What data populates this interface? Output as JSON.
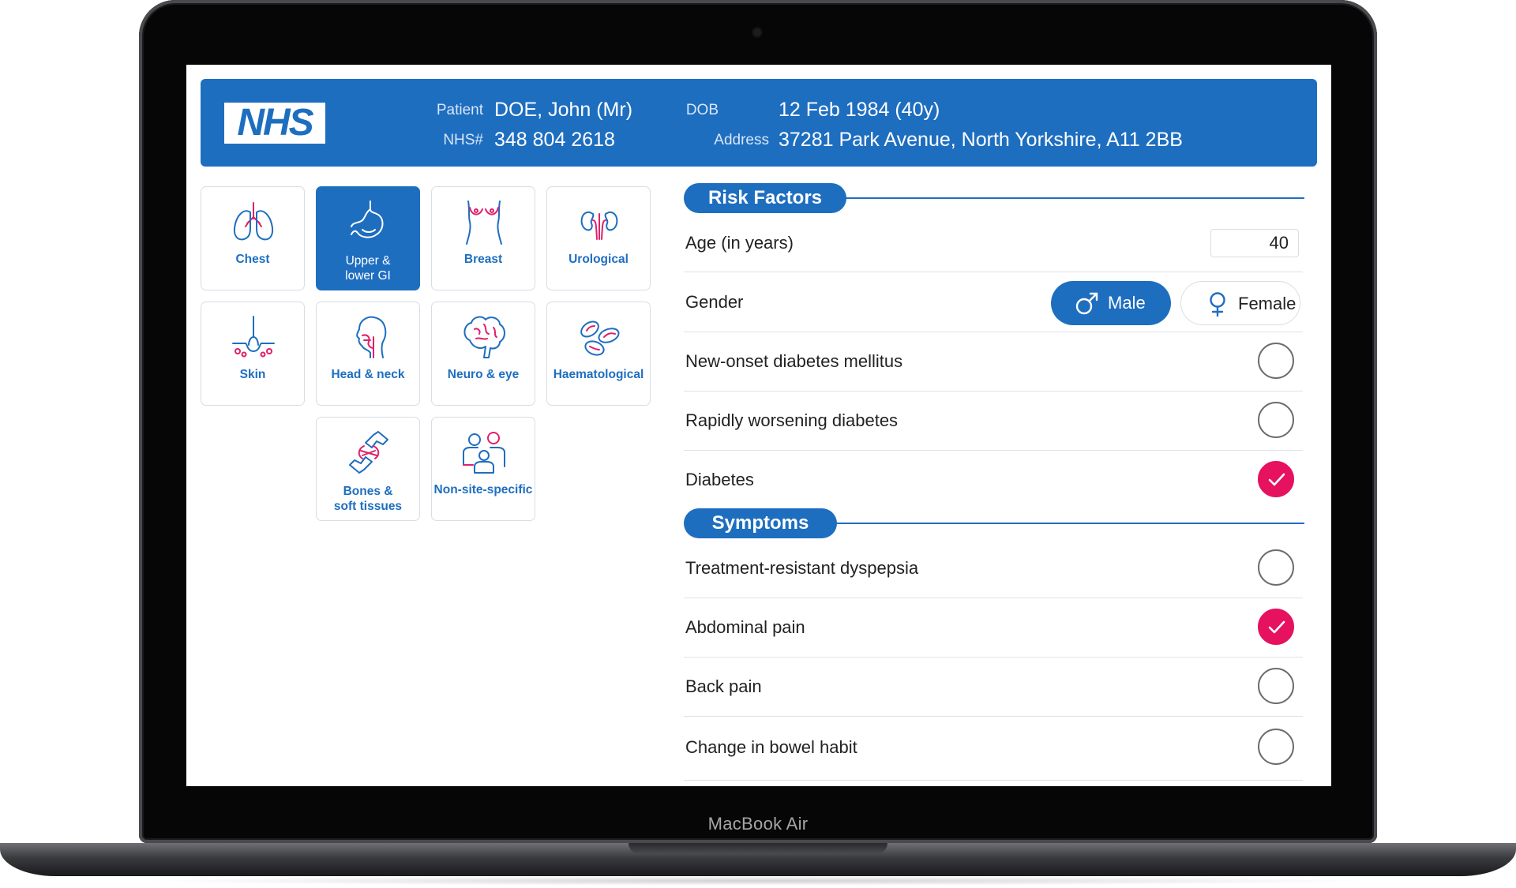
{
  "device": {
    "model_label": "MacBook Air"
  },
  "header": {
    "logo_text": "NHS",
    "patient_label": "Patient",
    "patient_name": "DOE, John (Mr)",
    "nhs_label": "NHS#",
    "nhs_number": "348 804 2618",
    "dob_label": "DOB",
    "dob_value": "12 Feb 1984 (40y)",
    "address_label": "Address",
    "address_value": "37281 Park Avenue, North Yorkshire, A11 2BB"
  },
  "categories": [
    {
      "label": "Chest",
      "icon": "lungs-icon",
      "active": false
    },
    {
      "label": "Upper & lower GI",
      "line1": "Upper &",
      "line2": "lower GI",
      "icon": "stomach-icon",
      "active": true
    },
    {
      "label": "Breast",
      "icon": "breast-icon",
      "active": false
    },
    {
      "label": "Urological",
      "icon": "kidneys-icon",
      "active": false
    },
    {
      "label": "Skin",
      "icon": "skin-hair-icon",
      "active": false
    },
    {
      "label": "Head & neck",
      "icon": "head-neck-icon",
      "active": false
    },
    {
      "label": "Neuro & eye",
      "icon": "brain-icon",
      "active": false
    },
    {
      "label": "Haematological",
      "icon": "blood-cells-icon",
      "active": false
    },
    {
      "label": "Bones & soft tissues",
      "line1": "Bones &",
      "line2": "soft tissues",
      "icon": "bone-joint-icon",
      "active": false
    },
    {
      "label": "Non-site-specific",
      "icon": "people-icon",
      "active": false
    }
  ],
  "risk_factors": {
    "title": "Risk Factors",
    "age_label": "Age (in years)",
    "age_value": "40",
    "gender_label": "Gender",
    "gender_options": [
      "Male",
      "Female"
    ],
    "gender_selected": "Male",
    "items": [
      {
        "label": "New-onset diabetes mellitus",
        "checked": false
      },
      {
        "label": "Rapidly worsening diabetes",
        "checked": false
      },
      {
        "label": "Diabetes",
        "checked": true
      }
    ]
  },
  "symptoms": {
    "title": "Symptoms",
    "items": [
      {
        "label": "Treatment-resistant dyspepsia",
        "checked": false
      },
      {
        "label": "Abdominal pain",
        "checked": true
      },
      {
        "label": "Back pain",
        "checked": false
      },
      {
        "label": "Change in bowel habit",
        "checked": false
      }
    ]
  },
  "colors": {
    "nhs_blue": "#1e6ec0",
    "check_pink": "#e6115f",
    "icon_pink": "#e0206a"
  }
}
